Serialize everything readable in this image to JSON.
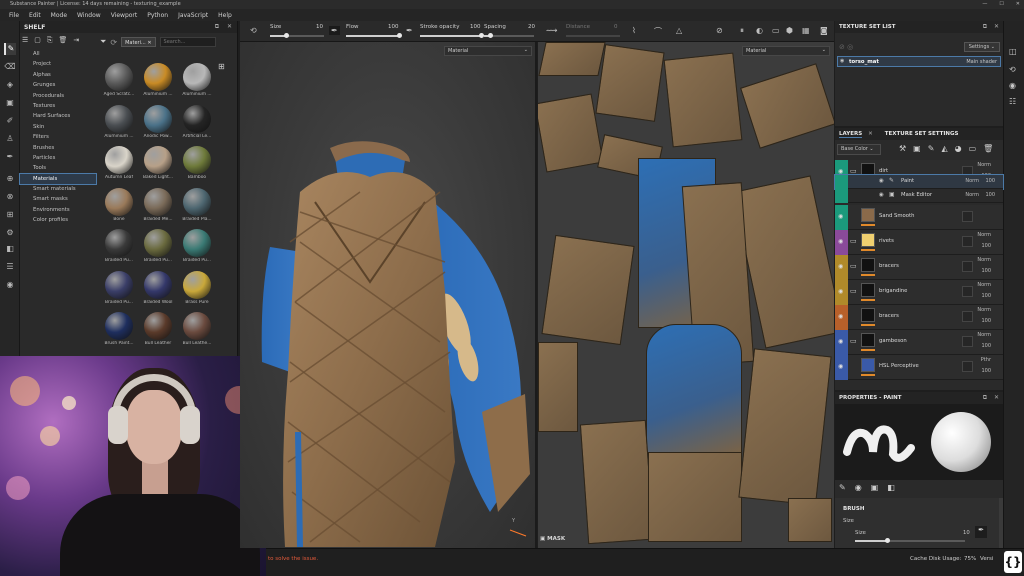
{
  "window": {
    "title": "Substance Painter | License: 14 days remaining - texturing_example"
  },
  "menu": [
    "File",
    "Edit",
    "Mode",
    "Window",
    "Viewport",
    "Python",
    "JavaScript",
    "Help"
  ],
  "brush_toolbar": {
    "size_label": "Size",
    "size_value": "10",
    "flow_label": "Flow",
    "flow_value": "100",
    "stroke_opacity_label": "Stroke opacity",
    "stroke_opacity_value": "100",
    "spacing_label": "Spacing",
    "spacing_value": "20",
    "distance_label": "Distance",
    "distance_value": "0"
  },
  "shelf": {
    "title": "SHELF",
    "filter_chip": "Materi...",
    "search_placeholder": "Search...",
    "categories": [
      "All",
      "Project",
      "Alphas",
      "Grunges",
      "Procedurals",
      "Textures",
      "Hard Surfaces",
      "Skin",
      "Filters",
      "Brushes",
      "Particles",
      "Tools",
      "Materials",
      "Smart materials",
      "Smart masks",
      "Environments",
      "Color profiles"
    ],
    "selected_category": "Materials",
    "materials": [
      {
        "name": "Aged Scratc...",
        "color": "#5a5a5a"
      },
      {
        "name": "Aluminium ...",
        "color": "#c98b25"
      },
      {
        "name": "Aluminium ...",
        "color": "#b8b8b8"
      },
      {
        "name": "Aluminium ...",
        "color": "#4a4e52"
      },
      {
        "name": "Anodic Pow...",
        "color": "#4a7188"
      },
      {
        "name": "Artificial Le...",
        "color": "#242424"
      },
      {
        "name": "Autumn Leaf",
        "color": "#d9d4c9"
      },
      {
        "name": "Baked Light...",
        "color": "#b7a088"
      },
      {
        "name": "Bamboo",
        "color": "#6e7a3a"
      },
      {
        "name": "Bone",
        "color": "#9a7a5a"
      },
      {
        "name": "Braided Me...",
        "color": "#7a6a58"
      },
      {
        "name": "Braided Pla...",
        "color": "#4d6670"
      },
      {
        "name": "Braided Pu...",
        "color": "#3a3a3a"
      },
      {
        "name": "Braided Pu...",
        "color": "#6a6a3e"
      },
      {
        "name": "Braided Pu...",
        "color": "#3a7a74"
      },
      {
        "name": "Braided Pu...",
        "color": "#3a3e68"
      },
      {
        "name": "Braided Wool",
        "color": "#34386a"
      },
      {
        "name": "Brass Pure",
        "color": "#c9a83a"
      },
      {
        "name": "Brush Paint...",
        "color": "#1e2e5e"
      },
      {
        "name": "Bull Leather",
        "color": "#5a3a2a"
      },
      {
        "name": "Bull Leathe...",
        "color": "#6a4a3e"
      }
    ]
  },
  "viewport": {
    "material_3d": "Material",
    "material_2d": "Material",
    "mask_label": "MASK"
  },
  "texture_set_list": {
    "title": "TEXTURE SET LIST",
    "settings_label": "Settings",
    "item_name": "torso_mat",
    "item_shader": "Main shader"
  },
  "layers": {
    "tab_layers": "LAYERS",
    "tab_texture_set_settings": "TEXTURE SET SETTINGS",
    "channel": "Base Color",
    "rows": [
      {
        "name": "dirt",
        "blend": "Norm",
        "opacity": "100",
        "color": "#1b9a7c",
        "type": "folder"
      },
      {
        "name": "Paint",
        "blend": "Norm",
        "opacity": "100",
        "color": "#1b9a7c",
        "type": "sub"
      },
      {
        "name": "Mask Editor",
        "blend": "Norm",
        "opacity": "100",
        "color": "#1b9a7c",
        "type": "sub"
      },
      {
        "name": "Sand Smooth",
        "blend": "",
        "opacity": "",
        "color": "#1b9a7c",
        "type": "fill"
      },
      {
        "name": "rivets",
        "blend": "Norm",
        "opacity": "100",
        "color": "#8a4a9a",
        "type": "folder"
      },
      {
        "name": "bracers",
        "blend": "Norm",
        "opacity": "100",
        "color": "#b08a2a",
        "type": "folder"
      },
      {
        "name": "brigandine",
        "blend": "Norm",
        "opacity": "100",
        "color": "#b08a2a",
        "type": "folder"
      },
      {
        "name": "bracers",
        "blend": "Norm",
        "opacity": "100",
        "color": "#b8602a",
        "type": "fill"
      },
      {
        "name": "gambeson",
        "blend": "Norm",
        "opacity": "100",
        "color": "#3a5aa8",
        "type": "folder"
      },
      {
        "name": "HSL Perceptive",
        "blend": "Pthr",
        "opacity": "100",
        "color": "#3a5aa8",
        "type": "fill"
      }
    ]
  },
  "properties": {
    "title": "PROPERTIES - PAINT",
    "section": "BRUSH",
    "size_label": "Size",
    "size_row_label": "Size",
    "size_value": "10"
  },
  "status": {
    "message": "to solve the issue.",
    "cache_label": "Cache Disk Usage:",
    "cache_value": "75%",
    "version_label": "Versi"
  }
}
